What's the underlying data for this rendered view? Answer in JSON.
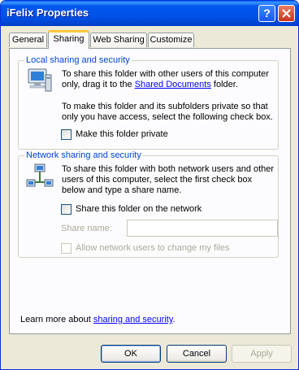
{
  "window": {
    "title": "iFelix Properties",
    "help_label": "?"
  },
  "tabs": [
    {
      "label": "General",
      "active": false
    },
    {
      "label": "Sharing",
      "active": true
    },
    {
      "label": "Web Sharing",
      "active": false
    },
    {
      "label": "Customize",
      "active": false
    }
  ],
  "local": {
    "legend": "Local sharing and security",
    "para1_prefix": "To share this folder with other users of this computer only, drag it to the ",
    "para1_link": "Shared Documents",
    "para1_suffix": " folder.",
    "para2": "To make this folder and its subfolders private so that only you have access, select the following check box.",
    "private_label": "Make this folder private",
    "private_checked": false,
    "icon": "computer-icon"
  },
  "network": {
    "legend": "Network sharing and security",
    "para": "To share this folder with both network users and other users of this computer, select the first check box below and type a share name.",
    "share_label": "Share this folder on the network",
    "share_checked": false,
    "share_name_label": "Share name:",
    "share_name_value": "",
    "allow_label": "Allow network users to change my files",
    "allow_checked": false,
    "icon": "network-icon"
  },
  "learn_more": {
    "prefix": "Learn more about ",
    "link": "sharing and security",
    "suffix": "."
  },
  "buttons": {
    "ok": "OK",
    "cancel": "Cancel",
    "apply": "Apply"
  }
}
